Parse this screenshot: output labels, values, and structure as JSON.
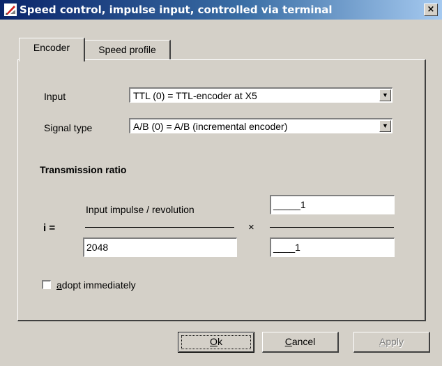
{
  "window": {
    "title": "Speed control, impulse input, controlled via terminal",
    "close_label": "×"
  },
  "tabs": [
    {
      "label": "Encoder",
      "selected": true
    },
    {
      "label": "Speed profile",
      "selected": false
    }
  ],
  "form": {
    "input_label": "Input",
    "input_value": "TTL (0) = TTL-encoder at X5",
    "signal_label": "Signal type",
    "signal_value": "A/B (0) = A/B (incremental encoder)"
  },
  "ratio": {
    "heading": "Transmission ratio",
    "i_label": "i =",
    "impulse_label": "Input impulse / revolution",
    "impulse_value": "2048",
    "times_symbol": "×",
    "numerator_value": "_____1",
    "denominator_value": "____1"
  },
  "adopt": {
    "first_letter": "a",
    "rest": "dopt immediately",
    "checked": false
  },
  "buttons": {
    "ok": {
      "first": "O",
      "rest": "k"
    },
    "cancel": {
      "first": "C",
      "rest": "ancel"
    },
    "apply": {
      "first": "A",
      "rest": "pply",
      "disabled": true
    }
  },
  "colors": {
    "face": "#d4d0c8",
    "title_start": "#0a246a",
    "title_end": "#a6caf0"
  }
}
